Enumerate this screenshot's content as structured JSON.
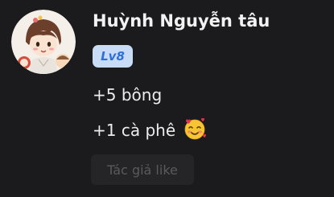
{
  "comment": {
    "username": "Huỳnh Nguyễn tâu",
    "level": "Lv8",
    "lines": [
      "+5 bông",
      "+1 cà phê"
    ],
    "emoji": "smiling-face-with-hearts",
    "author_like_label": "Tác giả like"
  },
  "colors": {
    "background": "#1b1b1d",
    "badge_bg": "#c9dcf7",
    "badge_text": "#2f6fd9",
    "chip_bg": "#252527",
    "chip_text": "#5a5a5d"
  }
}
